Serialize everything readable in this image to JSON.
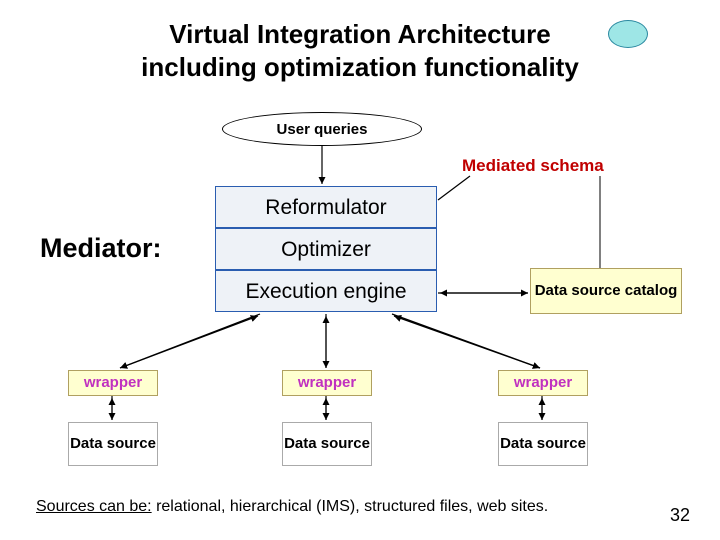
{
  "title_line1": "Virtual Integration Architecture",
  "title_line2": "including optimization functionality",
  "user_queries": "User queries",
  "mediated_schema": "Mediated schema",
  "mediator_label": "Mediator:",
  "stack": {
    "reformulator": "Reformulator",
    "optimizer": "Optimizer",
    "execution": "Execution engine"
  },
  "catalog": "Data source catalog",
  "wrapper_label": "wrapper",
  "data_source_label": "Data source",
  "footer_prefix": "Sources can be:",
  "footer_rest": " relational, hierarchical (IMS), structured files, web sites.",
  "page_number": "32"
}
